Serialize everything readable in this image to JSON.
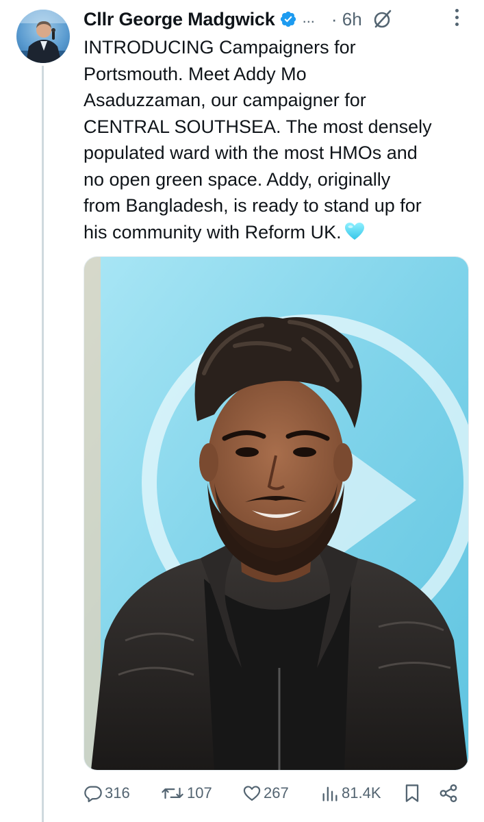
{
  "author": {
    "name": "Cllr George Madgwick",
    "verified": true,
    "truncated_marker": "...",
    "time": "· 6h"
  },
  "tweet": {
    "text_lines": [
      "INTRODUCING Campaigners for",
      "Portsmouth. Meet Addy Mo",
      "Asaduzzaman, our campaigner for",
      "CENTRAL SOUTHSEA. The most densely",
      "populated ward with the most HMOs and",
      "no open green space. Addy, originally",
      "from Bangladesh, is ready to stand up for",
      "his community with Reform UK."
    ],
    "emoji": "light-blue-heart"
  },
  "metrics": {
    "replies": "316",
    "reposts": "107",
    "likes": "267",
    "views": "81.4K"
  },
  "colors": {
    "text": "#0f1419",
    "secondary": "#536471",
    "verified": "#1d9bf0",
    "thread_line": "#cfd9de",
    "photo_background": "#7fd3ea"
  },
  "icons": {
    "verified": "verified-badge-icon",
    "grok": "grok-icon",
    "more": "more-options-icon",
    "reply": "reply-icon",
    "repost": "repost-icon",
    "like": "like-icon",
    "views": "views-icon",
    "bookmark": "bookmark-icon",
    "share": "share-icon"
  }
}
